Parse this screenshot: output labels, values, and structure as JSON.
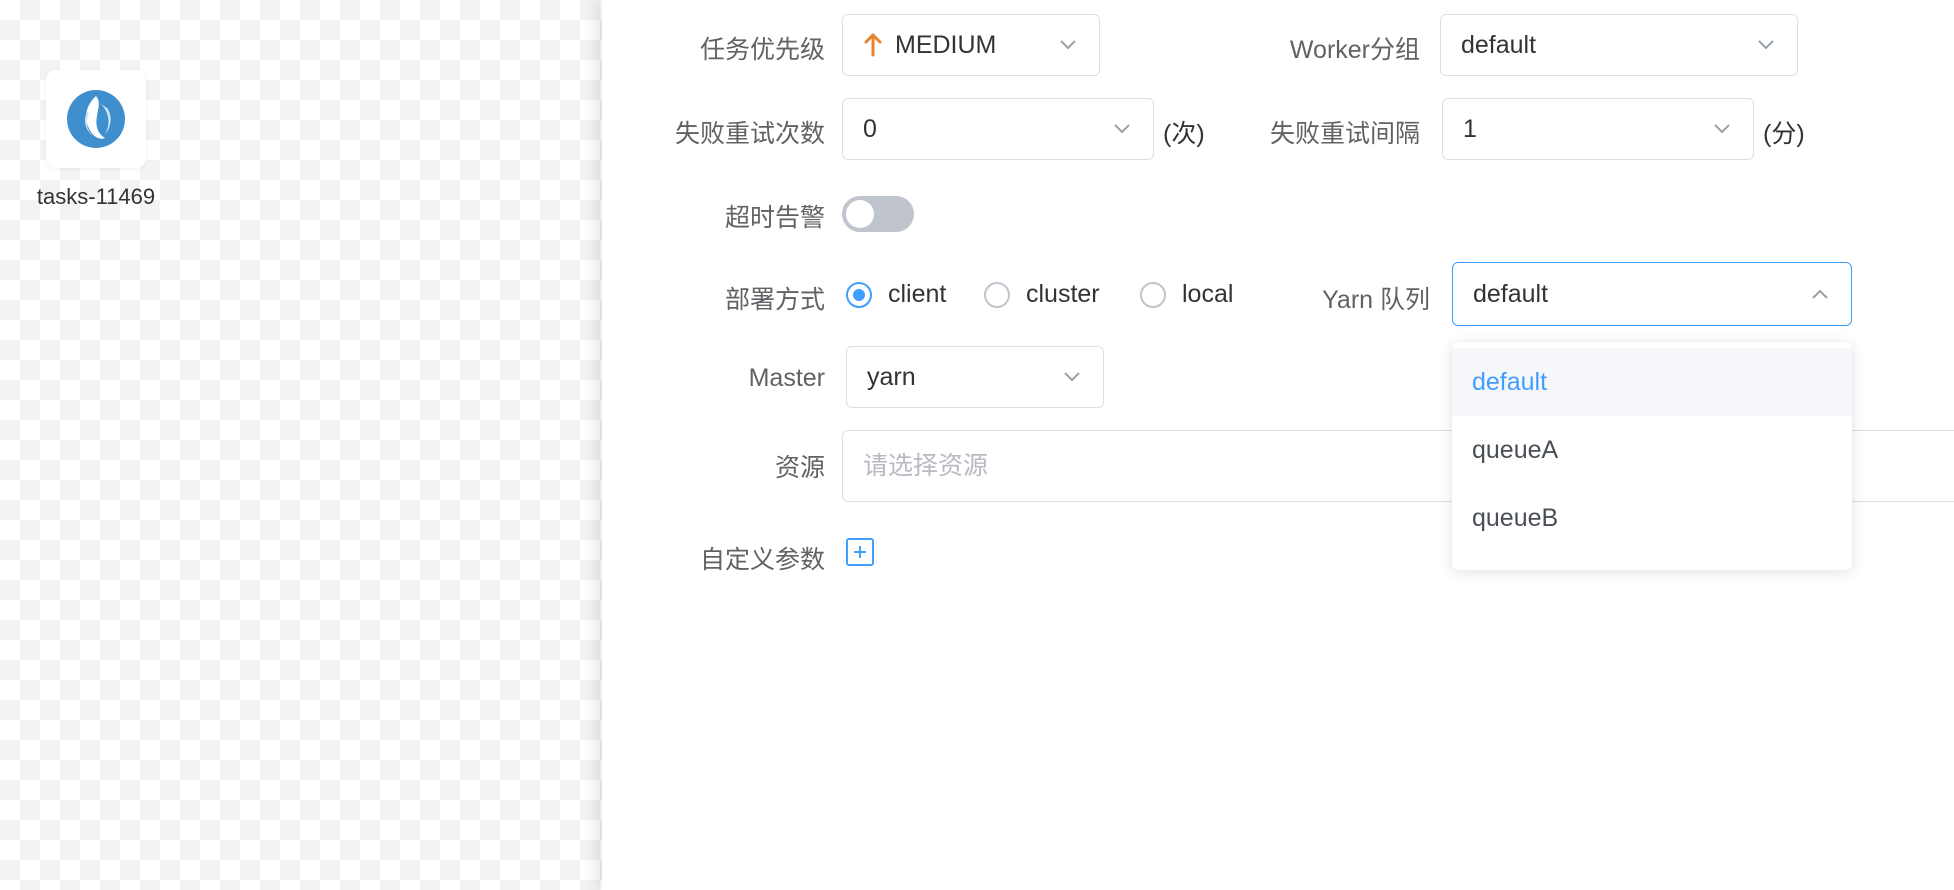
{
  "canvas": {
    "node_label": "tasks-11469"
  },
  "form": {
    "priority": {
      "label": "任务优先级",
      "value": "MEDIUM",
      "color": "#e6832b"
    },
    "worker_group": {
      "label": "Worker分组",
      "value": "default"
    },
    "retry_times": {
      "label": "失败重试次数",
      "value": "0",
      "unit": "(次)"
    },
    "retry_interval": {
      "label": "失败重试间隔",
      "value": "1",
      "unit": "(分)"
    },
    "timeout_alarm": {
      "label": "超时告警",
      "enabled": false
    },
    "deploy_mode": {
      "label": "部署方式",
      "options": [
        "client",
        "cluster",
        "local"
      ],
      "selected": "client"
    },
    "yarn_queue": {
      "label": "Yarn 队列",
      "value": "default"
    },
    "master": {
      "label": "Master",
      "value": "yarn"
    },
    "resource": {
      "label": "资源",
      "placeholder": "请选择资源"
    },
    "custom_params": {
      "label": "自定义参数"
    }
  },
  "dropdown": {
    "options": [
      "default",
      "queueA",
      "queueB"
    ],
    "selected": "default"
  },
  "colors": {
    "accent": "#409eff",
    "priority_arrow": "#e6832b"
  }
}
